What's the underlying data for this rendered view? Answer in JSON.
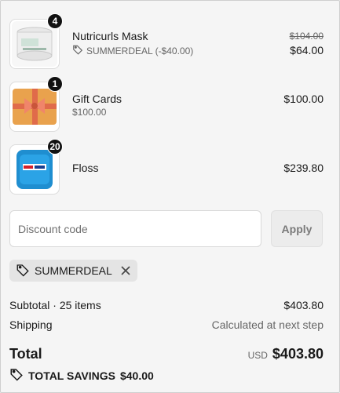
{
  "items": [
    {
      "name": "Nutricurls Mask",
      "quantity": "4",
      "discount_code": "SUMMERDEAL (-$40.00)",
      "original_price": "$104.00",
      "price": "$64.00"
    },
    {
      "name": "Gift Cards",
      "quantity": "1",
      "variant": "$100.00",
      "price": "$100.00"
    },
    {
      "name": "Floss",
      "quantity": "20",
      "price": "$239.80"
    }
  ],
  "discount": {
    "placeholder": "Discount code",
    "apply_label": "Apply",
    "applied_code": "SUMMERDEAL"
  },
  "summary": {
    "subtotal_label": "Subtotal · 25 items",
    "subtotal_value": "$403.80",
    "shipping_label": "Shipping",
    "shipping_value": "Calculated at next step",
    "total_label": "Total",
    "currency": "USD",
    "total_value": "$403.80",
    "savings_label": "TOTAL SAVINGS",
    "savings_value": "$40.00"
  },
  "icons": {
    "tag": "tag-icon",
    "close": "close-icon",
    "savings": "tag-icon"
  }
}
